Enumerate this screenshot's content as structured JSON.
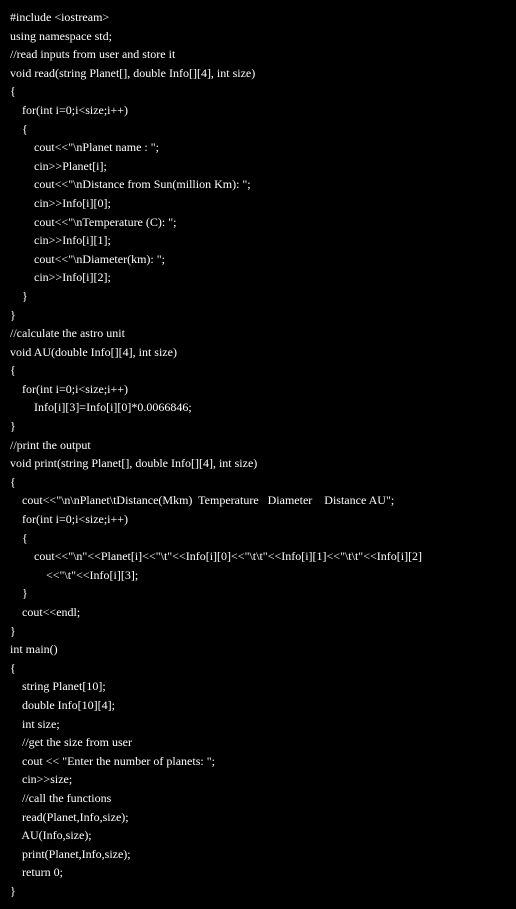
{
  "lines": [
    {
      "indent": 0,
      "text": "#include <iostream>"
    },
    {
      "indent": 0,
      "text": "using namespace std;"
    },
    {
      "indent": 0,
      "text": "//read inputs from user and store it"
    },
    {
      "indent": 0,
      "text": "void read(string Planet[], double Info[][4], int size)"
    },
    {
      "indent": 0,
      "text": "{"
    },
    {
      "indent": 1,
      "text": "for(int i=0;i<size;i++)"
    },
    {
      "indent": 1,
      "text": "{"
    },
    {
      "indent": 2,
      "text": "cout<<\"\\nPlanet name : \";"
    },
    {
      "indent": 2,
      "text": "cin>>Planet[i];"
    },
    {
      "indent": 2,
      "text": "cout<<\"\\nDistance from Sun(million Km): \";"
    },
    {
      "indent": 2,
      "text": "cin>>Info[i][0];"
    },
    {
      "indent": 2,
      "text": "cout<<\"\\nTemperature (C): \";"
    },
    {
      "indent": 2,
      "text": "cin>>Info[i][1];"
    },
    {
      "indent": 2,
      "text": "cout<<\"\\nDiameter(km): \";"
    },
    {
      "indent": 2,
      "text": "cin>>Info[i][2];"
    },
    {
      "indent": 0,
      "text": ""
    },
    {
      "indent": 1,
      "text": "}"
    },
    {
      "indent": 0,
      "text": "}"
    },
    {
      "indent": 0,
      "text": "//calculate the astro unit"
    },
    {
      "indent": 0,
      "text": "void AU(double Info[][4], int size)"
    },
    {
      "indent": 0,
      "text": "{"
    },
    {
      "indent": 1,
      "text": "for(int i=0;i<size;i++)"
    },
    {
      "indent": 2,
      "text": "Info[i][3]=Info[i][0]*0.0066846;"
    },
    {
      "indent": 0,
      "text": "}"
    },
    {
      "indent": 0,
      "text": "//print the output"
    },
    {
      "indent": 0,
      "text": "void print(string Planet[], double Info[][4], int size)"
    },
    {
      "indent": 0,
      "text": "{"
    },
    {
      "indent": 1,
      "text": "cout<<\"\\n\\nPlanet\\tDistance(Mkm)  Temperature   Diameter    Distance AU\";"
    },
    {
      "indent": 1,
      "text": "for(int i=0;i<size;i++)"
    },
    {
      "indent": 1,
      "text": "{"
    },
    {
      "indent": 2,
      "text": "cout<<\"\\n\"<<Planet[i]<<\"\\t\"<<Info[i][0]<<\"\\t\\t\"<<Info[i][1]<<\"\\t\\t\"<<Info[i][2]"
    },
    {
      "indent": 3,
      "text": "<<\"\\t\"<<Info[i][3];"
    },
    {
      "indent": 1,
      "text": "}"
    },
    {
      "indent": 1,
      "text": "cout<<endl;"
    },
    {
      "indent": 0,
      "text": "}"
    },
    {
      "indent": 0,
      "text": "int main()"
    },
    {
      "indent": 0,
      "text": "{"
    },
    {
      "indent": 1,
      "text": "string Planet[10];"
    },
    {
      "indent": 1,
      "text": "double Info[10][4];"
    },
    {
      "indent": 1,
      "text": "int size;"
    },
    {
      "indent": 1,
      "text": "//get the size from user"
    },
    {
      "indent": 1,
      "text": "cout << \"Enter the number of planets: \";"
    },
    {
      "indent": 1,
      "text": "cin>>size;"
    },
    {
      "indent": 1,
      "text": "//call the functions"
    },
    {
      "indent": 1,
      "text": "read(Planet,Info,size);"
    },
    {
      "indent": 1,
      "text": "AU(Info,size);"
    },
    {
      "indent": 1,
      "text": "print(Planet,Info,size);"
    },
    {
      "indent": 1,
      "text": "return 0;"
    },
    {
      "indent": 0,
      "text": "}"
    }
  ]
}
